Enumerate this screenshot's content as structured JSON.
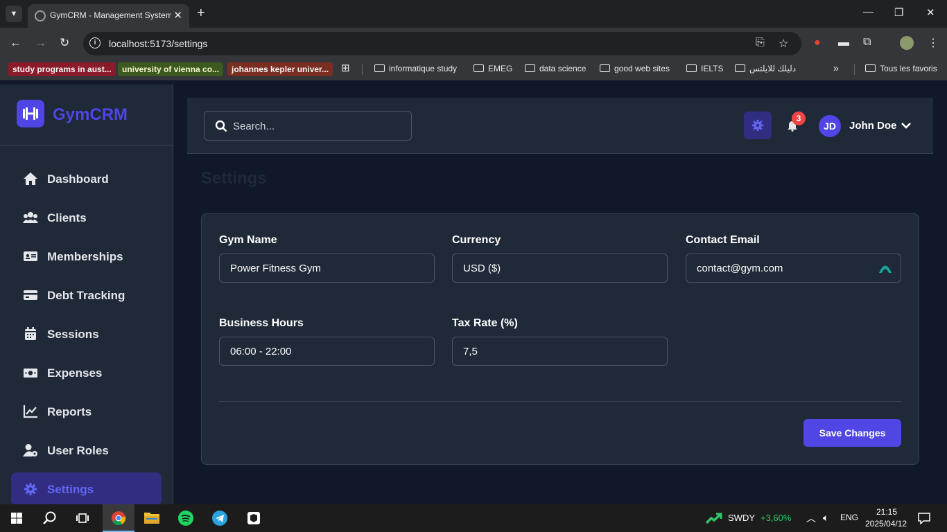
{
  "browser": {
    "tab_title": "GymCRM - Management System",
    "tab_close": "✕",
    "new_tab": "+",
    "url": "localhost:5173/settings",
    "bookmarks": {
      "chips": [
        {
          "label": "study programs in aust...",
          "color": "#8b1a2b"
        },
        {
          "label": "university of vienna co...",
          "color": "#3d5a1e"
        },
        {
          "label": "johannes kepler univer...",
          "color": "#7a2e22"
        }
      ],
      "folders": [
        "informatique study",
        "EMEG",
        "data science",
        "good web sites",
        "IELTS",
        "دليلك للايلتس"
      ],
      "overflow": "»",
      "all_bookmarks": "Tous les favoris"
    }
  },
  "app": {
    "brand": "GymCRM",
    "brand_color": "#4f46e5",
    "nav": [
      {
        "label": "Dashboard",
        "icon": "home-icon",
        "active": false
      },
      {
        "label": "Clients",
        "icon": "users-icon",
        "active": false
      },
      {
        "label": "Memberships",
        "icon": "id-card-icon",
        "active": false
      },
      {
        "label": "Debt Tracking",
        "icon": "credit-card-icon",
        "active": false
      },
      {
        "label": "Sessions",
        "icon": "calendar-icon",
        "active": false
      },
      {
        "label": "Expenses",
        "icon": "money-icon",
        "active": false
      },
      {
        "label": "Reports",
        "icon": "chart-line-icon",
        "active": false
      },
      {
        "label": "User Roles",
        "icon": "user-gear-icon",
        "active": false
      },
      {
        "label": "Settings",
        "icon": "gear-icon",
        "active": true
      }
    ],
    "search_placeholder": "Search...",
    "notification_count": "3",
    "user": {
      "initials": "JD",
      "name": "John Doe"
    },
    "page_title": "Settings",
    "form": {
      "gym_name": {
        "label": "Gym Name",
        "value": "Power Fitness Gym"
      },
      "currency": {
        "label": "Currency",
        "value": "USD ($)"
      },
      "contact_email": {
        "label": "Contact Email",
        "value": "contact@gym.com"
      },
      "business_hours": {
        "label": "Business Hours",
        "value": "06:00 - 22:00"
      },
      "tax_rate": {
        "label": "Tax Rate (%)",
        "value": "7,5"
      }
    },
    "save_label": "Save Changes"
  },
  "taskbar": {
    "stock_symbol": "SWDY",
    "stock_change": "+3,60%",
    "language": "ENG",
    "time": "21:15",
    "date": "2025/04/12"
  }
}
